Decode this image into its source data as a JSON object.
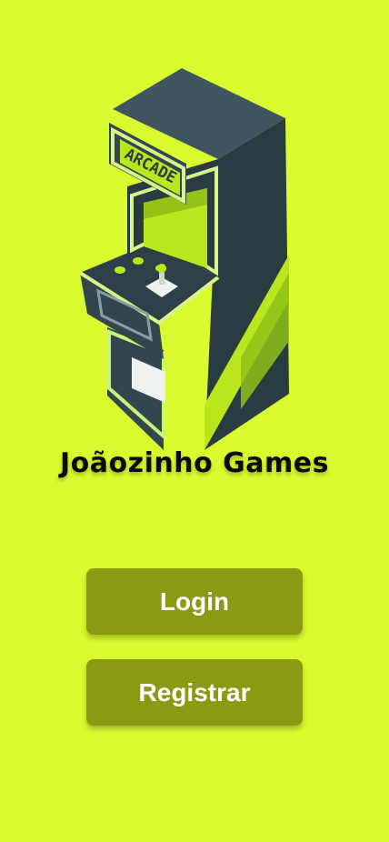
{
  "app": {
    "title": "Joãozinho Games"
  },
  "illustration": {
    "name": "arcade-machine",
    "marquee_text": "ARCADE"
  },
  "buttons": {
    "login_label": "Login",
    "register_label": "Registrar"
  },
  "colors": {
    "background": "#d9fb2f",
    "button": "#8a9a12",
    "button_text": "#ffffff",
    "title": "#0b0b0b"
  }
}
